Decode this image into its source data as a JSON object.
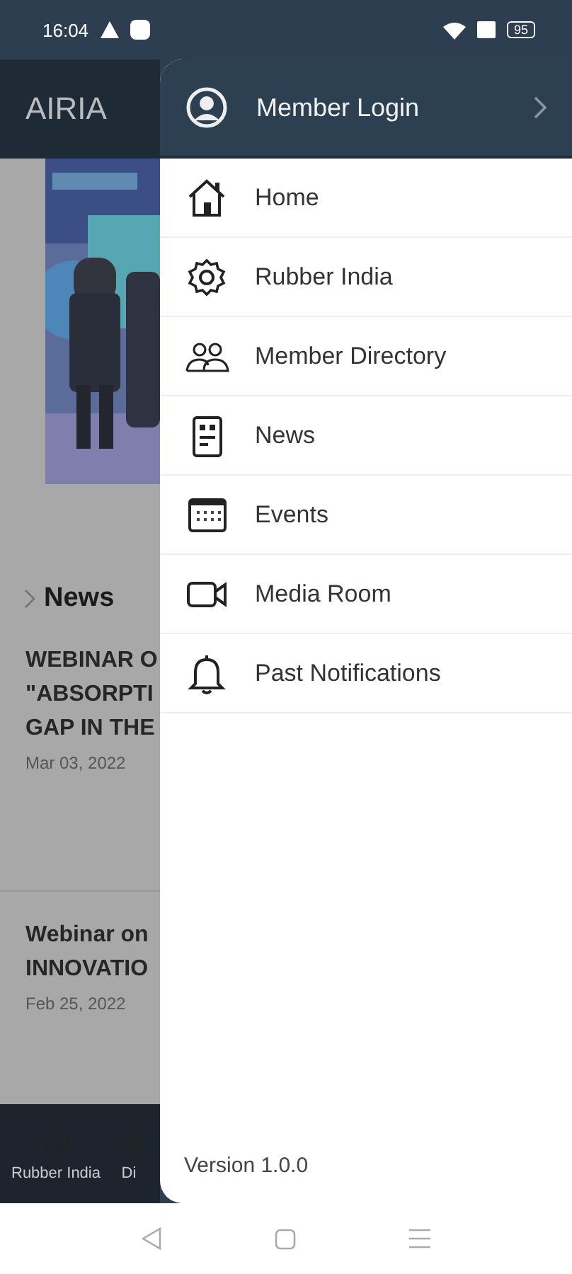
{
  "status_bar": {
    "time": "16:04",
    "battery": "95"
  },
  "app_bar": {
    "title": "AIRIA"
  },
  "section": {
    "title": "News"
  },
  "articles": [
    {
      "lines": [
        "WEBINAR O",
        "\"ABSORPTI",
        "GAP IN THE"
      ],
      "date": "Mar 03, 2022"
    },
    {
      "lines": [
        "Webinar on",
        "INNOVATIO"
      ],
      "date": "Feb 25, 2022"
    }
  ],
  "bottom_nav": [
    {
      "label": "Rubber India"
    },
    {
      "label": "Di"
    }
  ],
  "drawer": {
    "login": "Member Login",
    "items": [
      {
        "label": "Home"
      },
      {
        "label": "Rubber India"
      },
      {
        "label": "Member Directory"
      },
      {
        "label": "News"
      },
      {
        "label": "Events"
      },
      {
        "label": "Media Room"
      },
      {
        "label": "Past Notifications"
      }
    ],
    "version": "Version 1.0.0"
  }
}
